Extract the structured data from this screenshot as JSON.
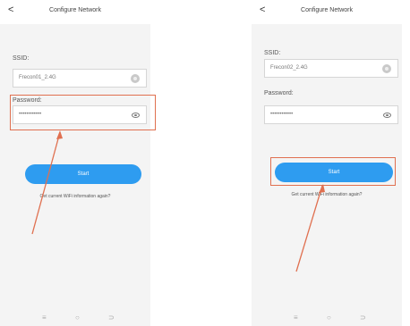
{
  "left_screen": {
    "back_label": "<",
    "title": "Configure Network",
    "ssid_label": "SSID:",
    "ssid_value": "Frecon01_2.4G",
    "password_label": "Password:",
    "password_value": "••••••••••••",
    "start_label": "Start",
    "hint_text": "Get current WiFi information again?"
  },
  "right_screen": {
    "back_label": "<",
    "title": "Configure Network",
    "ssid_label": "SSID:",
    "ssid_value": "Frecon02_2.4G",
    "password_label": "Password:",
    "password_value": "••••••••••••",
    "start_label": "Start",
    "hint_text": "Get current WiFi information again?"
  },
  "nav": {
    "menu": "≡",
    "home": "○",
    "back": "⊃"
  },
  "colors": {
    "accent": "#2e9cf0",
    "annotation": "#e07050"
  }
}
